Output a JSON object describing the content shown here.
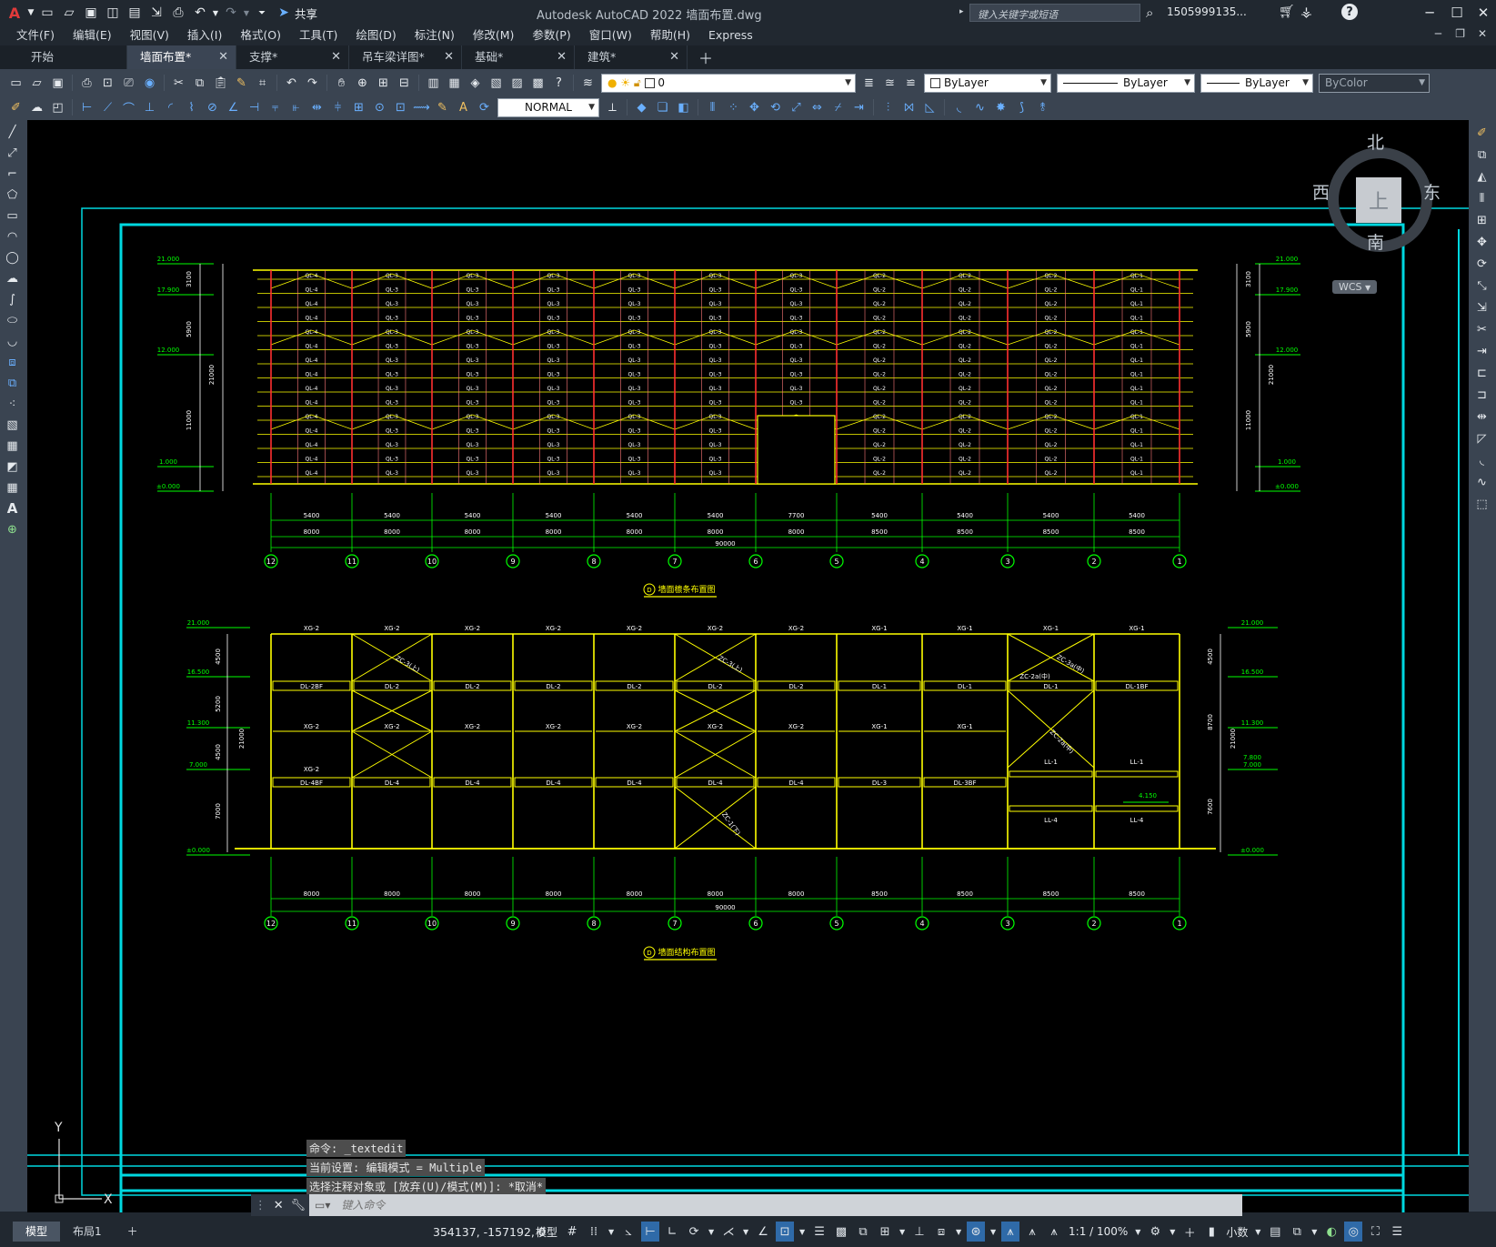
{
  "window": {
    "app_title": "Autodesk AutoCAD 2022    墙面布置.dwg",
    "share_label": "共享",
    "search_placeholder": "键入关键字或短语",
    "user": "1505999135..."
  },
  "menu": [
    "文件(F)",
    "编辑(E)",
    "视图(V)",
    "插入(I)",
    "格式(O)",
    "工具(T)",
    "绘图(D)",
    "标注(N)",
    "修改(M)",
    "参数(P)",
    "窗口(W)",
    "帮助(H)",
    "Express"
  ],
  "tabs": [
    {
      "label": "开始",
      "close": false
    },
    {
      "label": "墙面布置*",
      "close": true,
      "active": true
    },
    {
      "label": "支撑*",
      "close": true
    },
    {
      "label": "吊车梁详图*",
      "close": true
    },
    {
      "label": "基础*",
      "close": true
    },
    {
      "label": "建筑*",
      "close": true
    }
  ],
  "toolbar": {
    "layer_value": "0",
    "color": "ByLayer",
    "linetype": "ByLayer",
    "lineweight": "ByLayer",
    "plotstyle": "ByColor",
    "dimstyle": "NORMAL"
  },
  "viewcube": {
    "north": "北",
    "south": "南",
    "east": "东",
    "west": "西",
    "top": "上",
    "wcs": "WCS"
  },
  "drawing": {
    "title1": "墙面檩条布置图",
    "title2": "墙面结构布置图",
    "axis_marker": "D",
    "axes": [
      "12",
      "11",
      "10",
      "9",
      "8",
      "7",
      "6",
      "5",
      "4",
      "3",
      "2",
      "1"
    ],
    "total": "90000",
    "bay_spans": [
      "8000",
      "8000",
      "8000",
      "8000",
      "8000",
      "8000",
      "8000",
      "8500",
      "8500",
      "8500",
      "8500"
    ],
    "bay_sub": [
      "5400",
      "5400",
      "5400",
      "5400",
      "5400",
      "5400",
      "7700",
      "5400",
      "5400",
      "5400",
      "5400"
    ],
    "levels_upper": [
      "21.000",
      "17.900",
      "12.000",
      "1.000",
      "±0.000"
    ],
    "levels_lower": [
      "21.000",
      "16.500",
      "11.300",
      "7.000",
      "±0.000"
    ],
    "dims_left_upper": [
      "3100",
      "5900",
      "11000",
      "21000"
    ],
    "dims_left_lower": [
      "4500",
      "5200",
      "4500",
      "7000",
      "21000"
    ],
    "dims_right_lower": [
      "4500",
      "8700",
      "7600",
      "21000"
    ],
    "level_right_extra": "7.800",
    "level_right_extra2": "4.150",
    "purlins_upper": [
      "QL-4",
      "QL-3",
      "QL-3",
      "QL-3",
      "QL-3",
      "QL-3",
      "QL-3",
      "QL-2",
      "QL-2",
      "QL-2",
      "QL-1"
    ],
    "xg_top": [
      "XG-2",
      "XG-2",
      "XG-2",
      "XG-2",
      "XG-2",
      "XG-2",
      "XG-2",
      "XG-1",
      "XG-1",
      "XG-1",
      "XG-1"
    ],
    "dl_upper": [
      "DL-2BF",
      "DL-2",
      "DL-2",
      "DL-2",
      "DL-2",
      "DL-2",
      "DL-2",
      "DL-1",
      "DL-1",
      "DL-1",
      "DL-1BF"
    ],
    "xg_mid": [
      "XG-2",
      "XG-2",
      "XG-2",
      "XG-2",
      "XG-2",
      "XG-2",
      "XG-2",
      "XG-1",
      "XG-1"
    ],
    "xg_left_low": "XG-2",
    "dl_lower": [
      "DL-4BF",
      "DL-4",
      "DL-4",
      "DL-4",
      "DL-4",
      "DL-4",
      "DL-4",
      "DL-3",
      "DL-3BF"
    ],
    "ll": [
      "LL-1",
      "LL-1",
      "LL-4",
      "LL-4"
    ],
    "braces": [
      "ZC-3(上)",
      "ZC-3(上)",
      "ZC-3a(中)",
      "ZC-2a(中)",
      "ZC-2a(中)",
      "ZC-1(下)"
    ]
  },
  "command": {
    "history": [
      "命令: _textedit",
      "当前设置: 编辑模式 = Multiple",
      "选择注释对象或 [放弃(U)/模式(M)]: *取消*"
    ],
    "placeholder": "键入命令"
  },
  "status": {
    "layouts": [
      "模型",
      "布局1"
    ],
    "coords": "354137, -157192, 0",
    "space": "模型",
    "scale": "1:1 / 100%",
    "units": "小数"
  },
  "ucs": {
    "x": "X",
    "y": "Y"
  }
}
